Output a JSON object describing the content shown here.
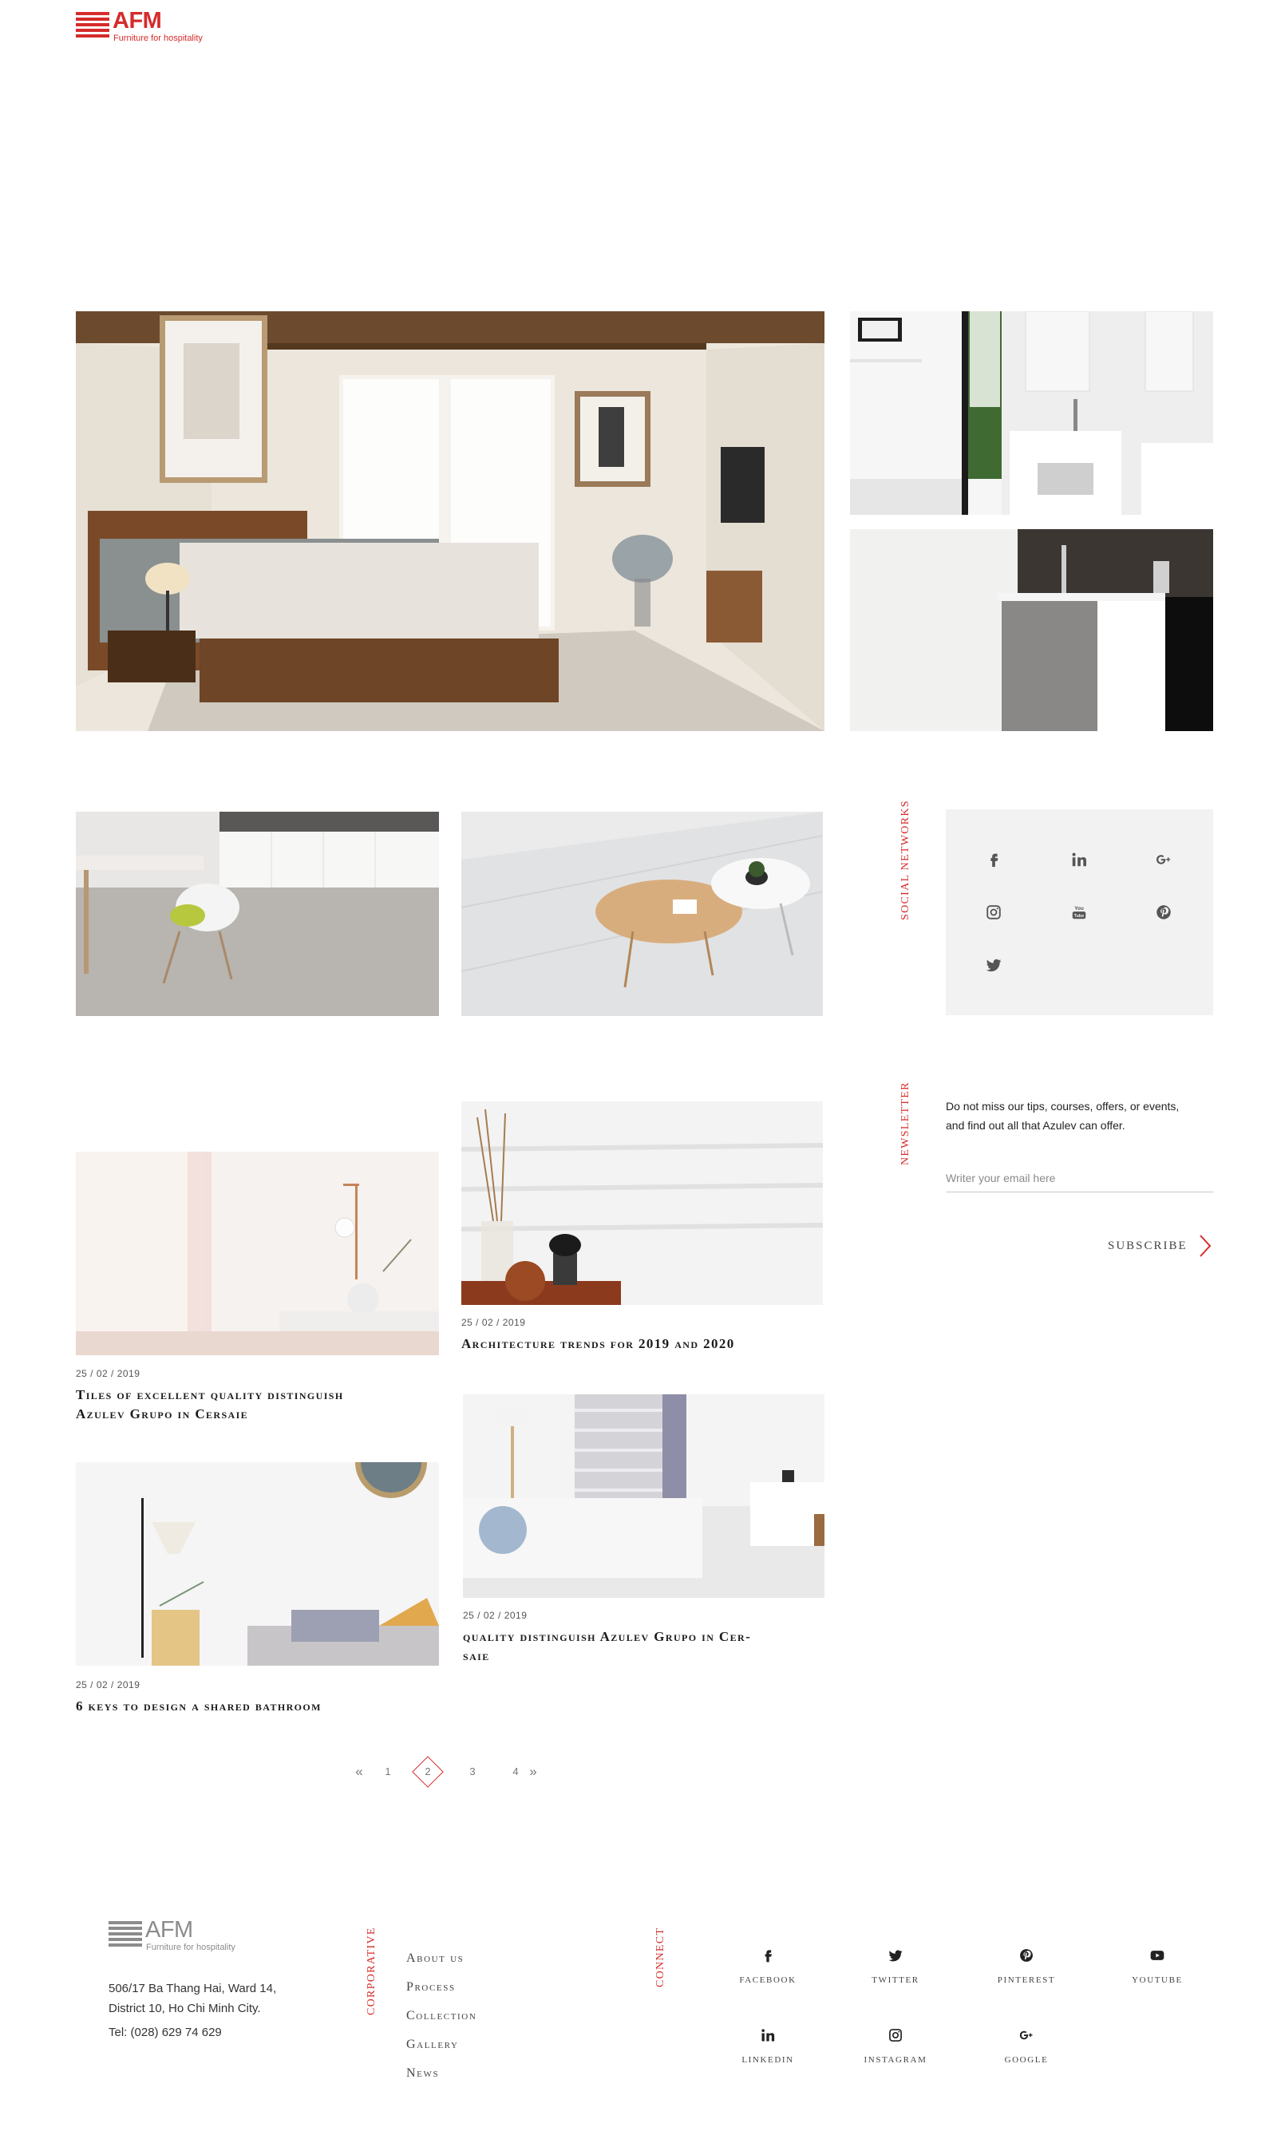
{
  "brand": {
    "name": "AFM",
    "tagline": "Furniture for hospitality",
    "accent_color": "#d62b2b",
    "footer_logo_color": "#8c8c8c"
  },
  "gallery": {
    "hero": {
      "alt": "bedroom"
    },
    "thumb_top": {
      "alt": "bathroom sink"
    },
    "thumb_bottom": {
      "alt": "bathroom vanity"
    }
  },
  "posts": [
    {
      "date": "",
      "title": "",
      "image": "kitchen"
    },
    {
      "date": "",
      "title": "",
      "image": "coffee table"
    },
    {
      "date": "25 / 02 / 2019",
      "title": "Architecture trends for 2019 and 2020",
      "image": "reed diffuser"
    },
    {
      "date": "25 / 02 / 2019",
      "title_line1": "Tiles of excellent quality distinguish",
      "title_line2": "Azulev Grupo in Cersaie",
      "image": "bedside lamp"
    },
    {
      "date": "25 / 02 / 2019",
      "title_line1": "quality distinguish Azulev Grupo in Cer-",
      "title_line2": "saie",
      "image": "living room sofa"
    },
    {
      "date": "25 / 02 / 2019",
      "title": "6 keys to design a shared bathroom",
      "image": "floor lamp"
    }
  ],
  "sidebar": {
    "social_label": "SOCIAL NETWORKS",
    "social_icons": [
      "facebook-icon",
      "linkedin-icon",
      "google-plus-icon",
      "instagram-icon",
      "youtube-icon",
      "pinterest-icon",
      "twitter-icon"
    ],
    "newsletter_label": "NEWSLETTER",
    "newsletter_line1": "Do not miss our tips, courses, offers, or events,",
    "newsletter_line2": "and find out all that Azulev can offer.",
    "email_placeholder": "Writer your email here",
    "subscribe_label": "SUBSCRIBE"
  },
  "pagination": {
    "prev": "«",
    "pages": [
      "1",
      "2",
      "3",
      "4"
    ],
    "current": "2",
    "next": "»"
  },
  "footer": {
    "address_line1": "506/17 Ba Thang Hai, Ward 14,",
    "address_line2": "District 10, Ho Chi Minh City.",
    "tel": "Tel: (028) 629 74 629",
    "corporative_label": "CORPORATIVE",
    "nav": [
      "About us",
      "Process",
      "Collection",
      "Gallery",
      "News"
    ],
    "connect_label": "CONNECT",
    "social": [
      {
        "label": "facebook",
        "icon": "facebook-icon"
      },
      {
        "label": "twitter",
        "icon": "twitter-icon"
      },
      {
        "label": "pinterest",
        "icon": "pinterest-icon"
      },
      {
        "label": "youtube",
        "icon": "youtube-icon"
      },
      {
        "label": "linkedin",
        "icon": "linkedin-icon"
      },
      {
        "label": "instagram",
        "icon": "instagram-icon"
      },
      {
        "label": "google",
        "icon": "google-plus-icon"
      }
    ]
  }
}
